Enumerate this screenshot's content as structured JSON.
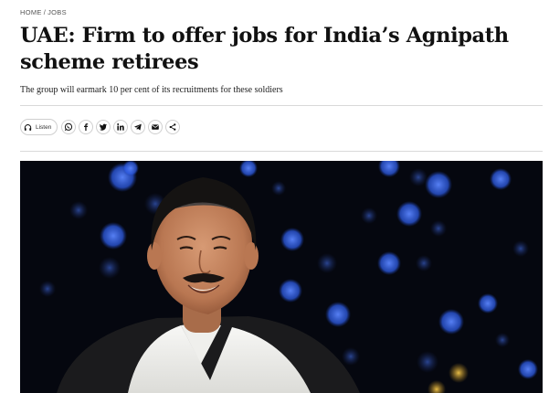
{
  "breadcrumb": {
    "home": "HOME",
    "separator": "/",
    "section": "JOBS"
  },
  "article": {
    "headline": "UAE: Firm to offer jobs for India’s Agnipath scheme retirees",
    "subheadline": "The group will earmark 10 per cent of its recruitments for these soldiers"
  },
  "share": {
    "listen_label": "Listen",
    "icons": [
      "headphones-icon",
      "whatsapp-icon",
      "facebook-icon",
      "twitter-icon",
      "linkedin-icon",
      "telegram-icon",
      "email-icon",
      "share-icon"
    ]
  },
  "colors": {
    "text": "#111111",
    "rule": "#d9d9d9",
    "photo_background": "#05070f",
    "bokeh": "#2d5be3"
  }
}
